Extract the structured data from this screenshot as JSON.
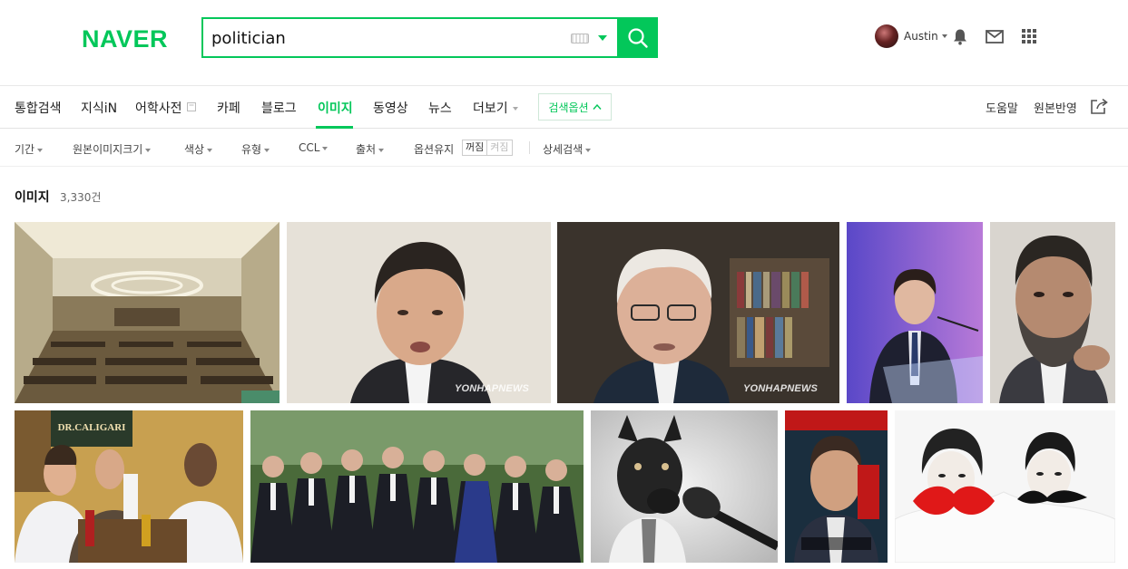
{
  "header": {
    "logo": "NAVER",
    "search_value": "politician",
    "user_name": "Austin"
  },
  "tabs": [
    {
      "label": "통합검색"
    },
    {
      "label": "지식iN"
    },
    {
      "label": "어학사전"
    },
    {
      "label": "카페"
    },
    {
      "label": "블로그"
    },
    {
      "label": "이미지",
      "active": true
    },
    {
      "label": "동영상"
    },
    {
      "label": "뉴스"
    },
    {
      "label": "더보기"
    }
  ],
  "search_options_label": "검색옵션",
  "right_links": {
    "help": "도움말",
    "feedback": "원본반영"
  },
  "filters": {
    "period": "기간",
    "size": "원본이미지크기",
    "color": "색상",
    "type": "유형",
    "ccl": "CCL",
    "source": "출처",
    "keep_options": "옵션유지",
    "toggle_on": "꺼짐",
    "toggle_off": "켜짐",
    "detail": "상세검색"
  },
  "results": {
    "title": "이미지",
    "count": "3,330건"
  },
  "images": [
    {
      "name": "assembly-hall",
      "watermark": ""
    },
    {
      "name": "man-speaking",
      "watermark": "YONHAPNEWS"
    },
    {
      "name": "older-man-glasses",
      "watermark": "YONHAPNEWS"
    },
    {
      "name": "man-at-podium",
      "watermark": ""
    },
    {
      "name": "bearded-man",
      "watermark": ""
    },
    {
      "name": "leaders-eating",
      "watermark": ""
    },
    {
      "name": "crowd-of-officials",
      "watermark": ""
    },
    {
      "name": "dog-microphone",
      "watermark": ""
    },
    {
      "name": "magazine-cover",
      "watermark": ""
    },
    {
      "name": "couple-illustration",
      "watermark": ""
    }
  ],
  "colors": {
    "brand": "#03c75a"
  }
}
